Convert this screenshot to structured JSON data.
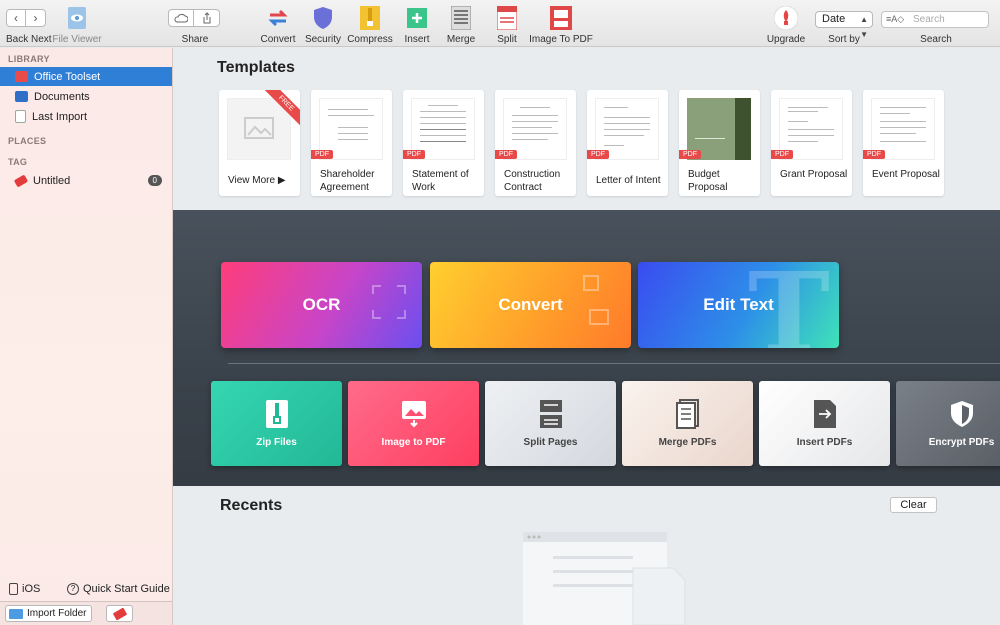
{
  "toolbar": {
    "back_next_label": "Back Next",
    "file_viewer_label": "File Viewer",
    "share_label": "Share",
    "convert_label": "Convert",
    "security_label": "Security",
    "compress_label": "Compress",
    "insert_label": "Insert",
    "merge_label": "Merge",
    "split_label": "Split",
    "image_to_pdf_label": "Image To PDF",
    "upgrade_label": "Upgrade",
    "sort_value": "Date",
    "sort_label": "Sort by",
    "search_placeholder": "Search",
    "search_label": "Search"
  },
  "sidebar": {
    "library_head": "LIBRARY",
    "items": [
      {
        "label": "Office Toolset"
      },
      {
        "label": "Documents"
      },
      {
        "label": "Last Import"
      }
    ],
    "places_head": "PLACES",
    "tag_head": "TAG",
    "tag_item": {
      "label": "Untitled",
      "count": "0"
    },
    "ios_label": "iOS",
    "quickstart_label": "Quick Start Guide",
    "import_label": "Import Folder"
  },
  "templates": {
    "title": "Templates",
    "free_ribbon": "FREE",
    "pdf_tag": "PDF",
    "cards": [
      {
        "label": "View More ▶"
      },
      {
        "label": "Shareholder Agreement"
      },
      {
        "label": "Statement of Work"
      },
      {
        "label": "Construction Contract"
      },
      {
        "label": "Letter of Intent"
      },
      {
        "label": "Budget Proposal"
      },
      {
        "label": "Grant Proposal"
      },
      {
        "label": "Event Proposal"
      }
    ]
  },
  "features": {
    "ocr": "OCR",
    "convert": "Convert",
    "edit_text": "Edit Text"
  },
  "tools": [
    {
      "label": "Zip Files"
    },
    {
      "label": "Image to PDF"
    },
    {
      "label": "Split Pages"
    },
    {
      "label": "Merge PDFs"
    },
    {
      "label": "Insert PDFs"
    },
    {
      "label": "Encrypt PDFs"
    }
  ],
  "recents": {
    "title": "Recents",
    "clear_label": "Clear"
  },
  "colors": {
    "accent": "#2f7fd6",
    "pdf_red": "#e84a4a"
  }
}
